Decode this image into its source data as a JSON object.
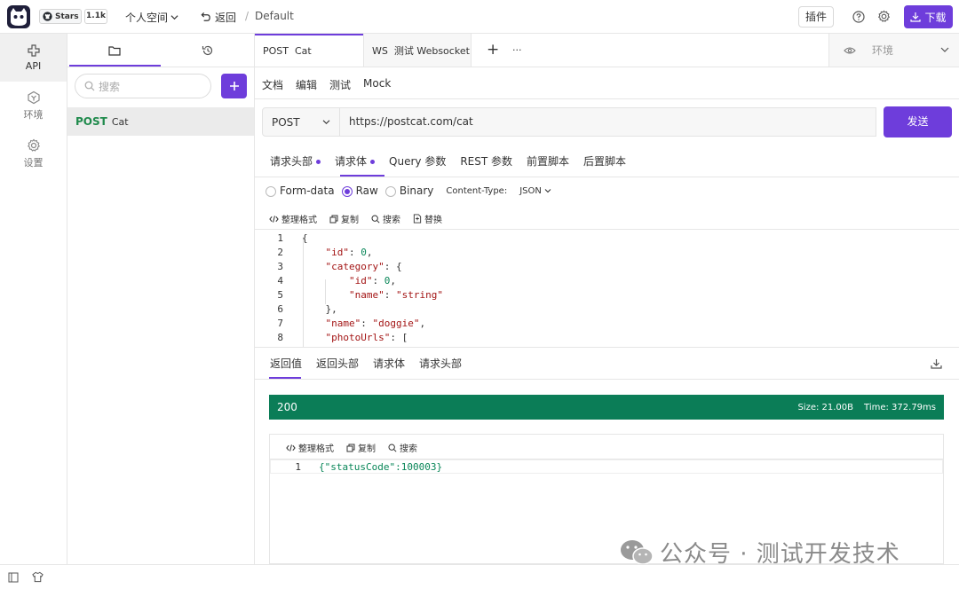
{
  "topbar": {
    "stars_label": "Stars",
    "stars_count": "1.1k",
    "workspace": "个人空间",
    "back_label": "返回",
    "separator": "/",
    "project": "Default",
    "plugin_label": "插件",
    "download_label": "下载"
  },
  "leftnav": {
    "items": [
      {
        "label": "API",
        "icon": "api-icon"
      },
      {
        "label": "环境",
        "icon": "environment-icon"
      },
      {
        "label": "设置",
        "icon": "settings-icon"
      }
    ]
  },
  "sidebar": {
    "search_placeholder": "搜索",
    "api_item": {
      "method": "POST",
      "name": "Cat"
    }
  },
  "tabs": {
    "items": [
      "POST  Cat",
      "WS  测试 Websocket"
    ],
    "add": "+",
    "more": "···",
    "env_placeholder": "环境"
  },
  "subtabs": [
    "文档",
    "编辑",
    "测试",
    "Mock"
  ],
  "request": {
    "method": "POST",
    "url": "https://postcat.com/cat",
    "send_label": "发送"
  },
  "param_tabs": [
    "请求头部",
    "请求体",
    "Query 参数",
    "REST 参数",
    "前置脚本",
    "后置脚本"
  ],
  "body_types": [
    "Form-data",
    "Raw",
    "Binary"
  ],
  "content_type_label": "Content-Type:",
  "content_type_value": "JSON",
  "editor_tools": [
    "整理格式",
    "复制",
    "搜索",
    "替换"
  ],
  "code_lines": [
    {
      "n": "1",
      "text": "{"
    },
    {
      "n": "2",
      "text": "    \"id\": 0,"
    },
    {
      "n": "3",
      "text": "    \"category\": {"
    },
    {
      "n": "4",
      "text": "        \"id\": 0,"
    },
    {
      "n": "5",
      "text": "        \"name\": \"string\""
    },
    {
      "n": "6",
      "text": "    },"
    },
    {
      "n": "7",
      "text": "    \"name\": \"doggie\","
    },
    {
      "n": "8",
      "text": "    \"photoUrls\": ["
    }
  ],
  "response": {
    "tabs": [
      "返回值",
      "返回头部",
      "请求体",
      "请求头部"
    ],
    "status": "200",
    "size": "Size: 21.00B",
    "time": "Time: 372.79ms",
    "tools": [
      "整理格式",
      "复制",
      "搜索"
    ],
    "line_no": "1",
    "body": "{\"statusCode\":100003}"
  },
  "watermark": "公众号 · 测试开发技术",
  "colors": {
    "accent": "#6e3ddb",
    "success": "#0b7d57",
    "post": "#1f8a4c"
  }
}
